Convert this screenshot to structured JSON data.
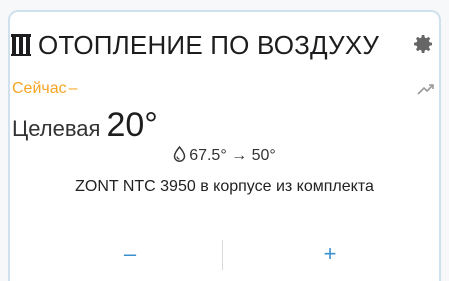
{
  "widget": {
    "title": "ОТОПЛЕНИЕ ПО ВОЗДУХУ",
    "header_icon": "radiator-icon",
    "settings_icon": "gear-icon",
    "now": {
      "label": "Сейчас",
      "value": "–",
      "trend_icon": "trend-arrow-icon"
    },
    "target": {
      "label": "Целевая",
      "value": "20°"
    },
    "range": {
      "icon": "water-drop-icon",
      "text": "67.5° → 50°"
    },
    "sensor": "ZONT NTC 3950 в корпусе из комплекта",
    "controls": {
      "minus": "–",
      "plus": "+"
    },
    "colors": {
      "accent": "#3a8fcf",
      "now": "#f5a524",
      "border": "#cfe1ec"
    }
  }
}
